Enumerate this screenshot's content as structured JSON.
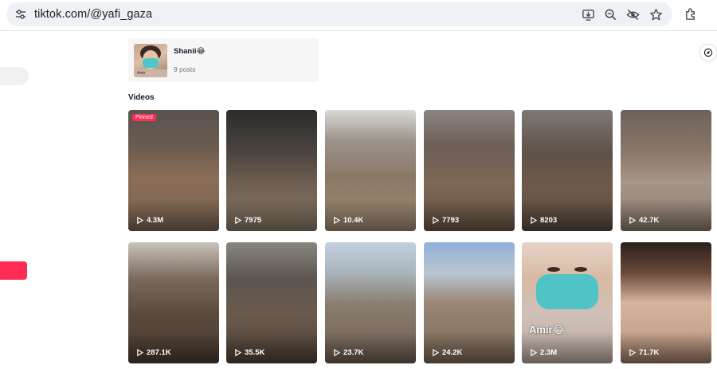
{
  "browser": {
    "url": "tiktok.com/@yafi_gaza"
  },
  "playlist": {
    "title": "Shanii😂",
    "count": "9 posts"
  },
  "section": {
    "videos_label": "Videos"
  },
  "videos": [
    {
      "views": "4.3M",
      "pinned_label": "Pinned"
    },
    {
      "views": "7975"
    },
    {
      "views": "10.4K"
    },
    {
      "views": "7793"
    },
    {
      "views": "8203"
    },
    {
      "views": "42.7K"
    },
    {
      "views": "287.1K"
    },
    {
      "views": "35.5K"
    },
    {
      "views": "23.7K"
    },
    {
      "views": "24.2K"
    },
    {
      "views": "2.3M",
      "caption": "Amir😂"
    },
    {
      "views": "71.7K"
    }
  ],
  "colors": {
    "accent": "#fe2c55",
    "omnibox": "#eef1f6"
  }
}
